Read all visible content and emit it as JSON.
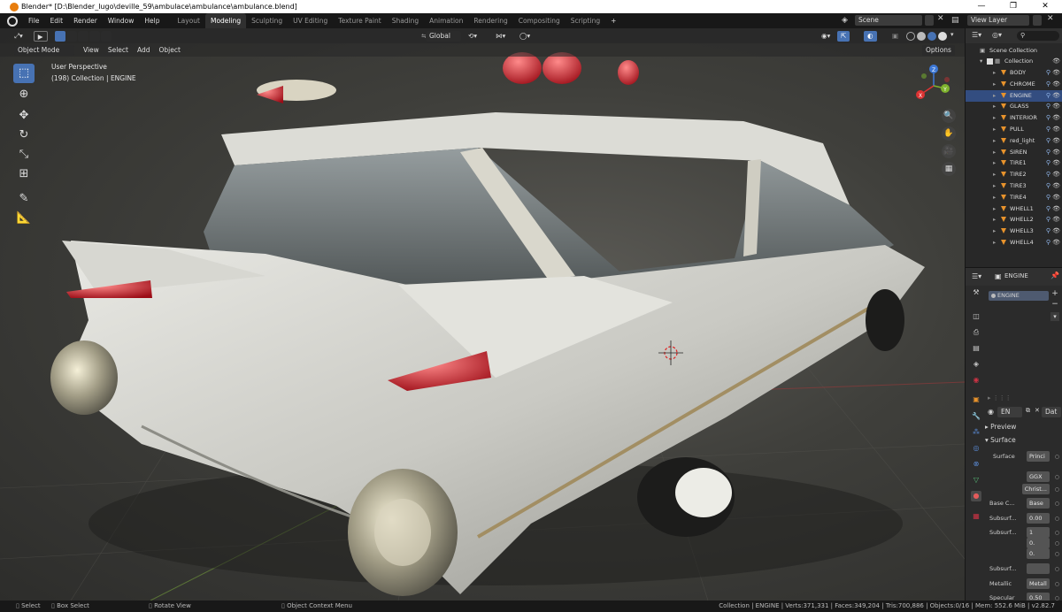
{
  "window": {
    "title": "Blender* [D:\\Blender_lugo\\deville_59\\ambulace\\ambulance\\ambulance.blend]",
    "minimize": "—",
    "maximize": "❐",
    "close": "✕"
  },
  "menus": [
    "File",
    "Edit",
    "Render",
    "Window",
    "Help"
  ],
  "workspaces": [
    "Layout",
    "Modeling",
    "Sculpting",
    "UV Editing",
    "Texture Paint",
    "Shading",
    "Animation",
    "Rendering",
    "Compositing",
    "Scripting"
  ],
  "add_workspace": "+",
  "scene": {
    "label": "Scene"
  },
  "view_layer": {
    "label": "View Layer"
  },
  "viewport": {
    "mode": "Object Mode",
    "menus": [
      "View",
      "Select",
      "Add",
      "Object"
    ],
    "transform_orientation": "Global",
    "options_label": "Options",
    "overlay_line1": "User Perspective",
    "overlay_line2": "(198) Collection | ENGINE"
  },
  "tools": [
    {
      "name": "select-box-tool",
      "glyph": "⬚",
      "active": true
    },
    {
      "name": "cursor-tool",
      "glyph": "⊕",
      "active": false
    },
    {
      "name": "move-tool",
      "glyph": "✥",
      "active": false
    },
    {
      "name": "rotate-tool",
      "glyph": "↻",
      "active": false
    },
    {
      "name": "scale-tool",
      "glyph": "⤡",
      "active": false
    },
    {
      "name": "transform-tool",
      "glyph": "⊞",
      "active": false
    },
    {
      "name": "annotate-tool",
      "glyph": "✎",
      "active": false
    },
    {
      "name": "measure-tool",
      "glyph": "📐",
      "active": false
    }
  ],
  "gizmo": {
    "x": "X",
    "y": "Y",
    "z": "Z"
  },
  "outliner": {
    "root": "Scene Collection",
    "collection": "Collection",
    "objects": [
      "BODY",
      "CHROME",
      "ENGINE",
      "GLASS",
      "INTERIOR",
      "PULL",
      "red_light",
      "SIREN",
      "TIRE1",
      "TIRE2",
      "TIRE3",
      "TIRE4",
      "WHELL1",
      "WHELL2",
      "WHELL3",
      "WHELL4"
    ],
    "selected": "ENGINE"
  },
  "properties": {
    "object_name": "ENGINE",
    "material_slot": "ENGINE",
    "material_field": "EN",
    "material_users": "Dat",
    "panels": {
      "preview": "Preview",
      "surface": "Surface"
    },
    "rows": [
      {
        "label": "Surface",
        "value": "Princi"
      },
      {
        "label": "",
        "value": "GGX"
      },
      {
        "label": "",
        "value": "Christ..."
      },
      {
        "label": "Base C...",
        "value": "Base"
      },
      {
        "label": "Subsurf...",
        "value": "0.00"
      },
      {
        "label": "Subsurf...",
        "value": "1"
      },
      {
        "label": "",
        "value": "0."
      },
      {
        "label": "",
        "value": "0."
      },
      {
        "label": "Subsurf...",
        "value": ""
      },
      {
        "label": "Metallic",
        "value": "Metall"
      },
      {
        "label": "Specular",
        "value": "0.50"
      }
    ]
  },
  "statusbar": {
    "left": [
      {
        "icon": "mouse-left-icon",
        "label": "Select"
      },
      {
        "icon": "mouse-drag-icon",
        "label": "Box Select"
      },
      {
        "icon": "mouse-middle-icon",
        "label": "Rotate View"
      },
      {
        "icon": "mouse-right-icon",
        "label": "Object Context Menu"
      }
    ],
    "stats": "Collection | ENGINE | Verts:371,331 | Faces:349,204 | Tris:700,886 | Objects:0/16 | Mem: 552.6 MiB | v2.82.7"
  },
  "colors": {
    "accent": "#4772b3",
    "object_icon": "#e8932c",
    "selected_row": "#334d80",
    "panel_bg": "#2b2b2b"
  }
}
